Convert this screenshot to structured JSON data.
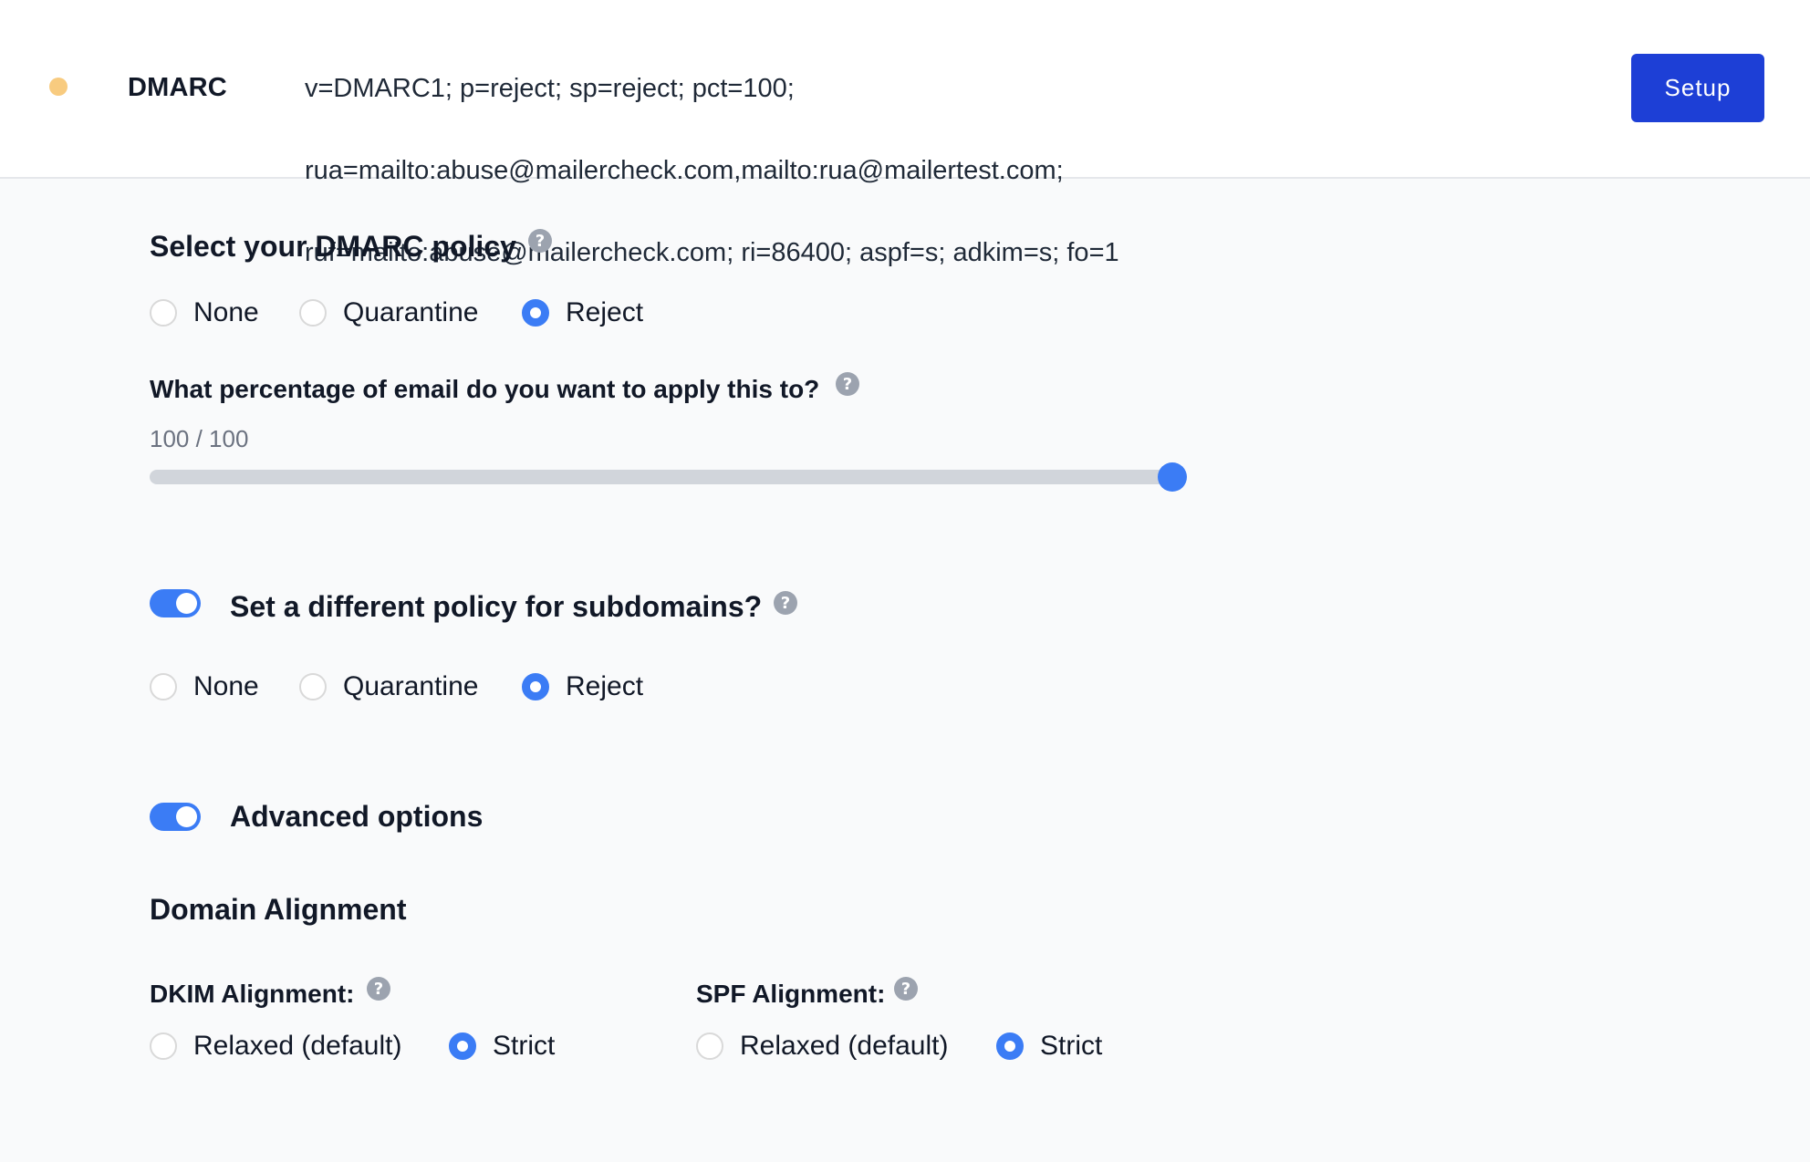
{
  "colors": {
    "accent": "#3b7cf5",
    "button": "#1d3fd6",
    "status_dot": "#f8cb7f",
    "help_icon": "#9ca3af"
  },
  "header": {
    "status": "warning",
    "record_name": "DMARC",
    "record_value_lines": [
      "v=DMARC1; p=reject; sp=reject; pct=100;",
      "rua=mailto:abuse@mailercheck.com,mailto:rua@mailertest.com;",
      "ruf=mailto:abuse@mailercheck.com; ri=86400; aspf=s; adkim=s; fo=1"
    ],
    "setup_label": "Setup"
  },
  "policy": {
    "title": "Select your DMARC policy",
    "help_icon": "question-circle-icon",
    "options": [
      {
        "label": "None",
        "checked": false
      },
      {
        "label": "Quarantine",
        "checked": false
      },
      {
        "label": "Reject",
        "checked": true
      }
    ]
  },
  "percentage": {
    "title": "What percentage of email do you want to apply this to?",
    "value_text": "100 / 100",
    "value": 100,
    "max": 100
  },
  "subdomain": {
    "toggle_on": true,
    "label": "Set a different policy for subdomains?",
    "options": [
      {
        "label": "None",
        "checked": false
      },
      {
        "label": "Quarantine",
        "checked": false
      },
      {
        "label": "Reject",
        "checked": true
      }
    ]
  },
  "advanced": {
    "toggle_on": true,
    "label": "Advanced options"
  },
  "alignment": {
    "title": "Domain Alignment",
    "dkim": {
      "label": "DKIM Alignment:",
      "options": [
        {
          "label": "Relaxed (default)",
          "checked": false
        },
        {
          "label": "Strict",
          "checked": true
        }
      ]
    },
    "spf": {
      "label": "SPF Alignment:",
      "options": [
        {
          "label": "Relaxed (default)",
          "checked": false
        },
        {
          "label": "Strict",
          "checked": true
        }
      ]
    }
  }
}
